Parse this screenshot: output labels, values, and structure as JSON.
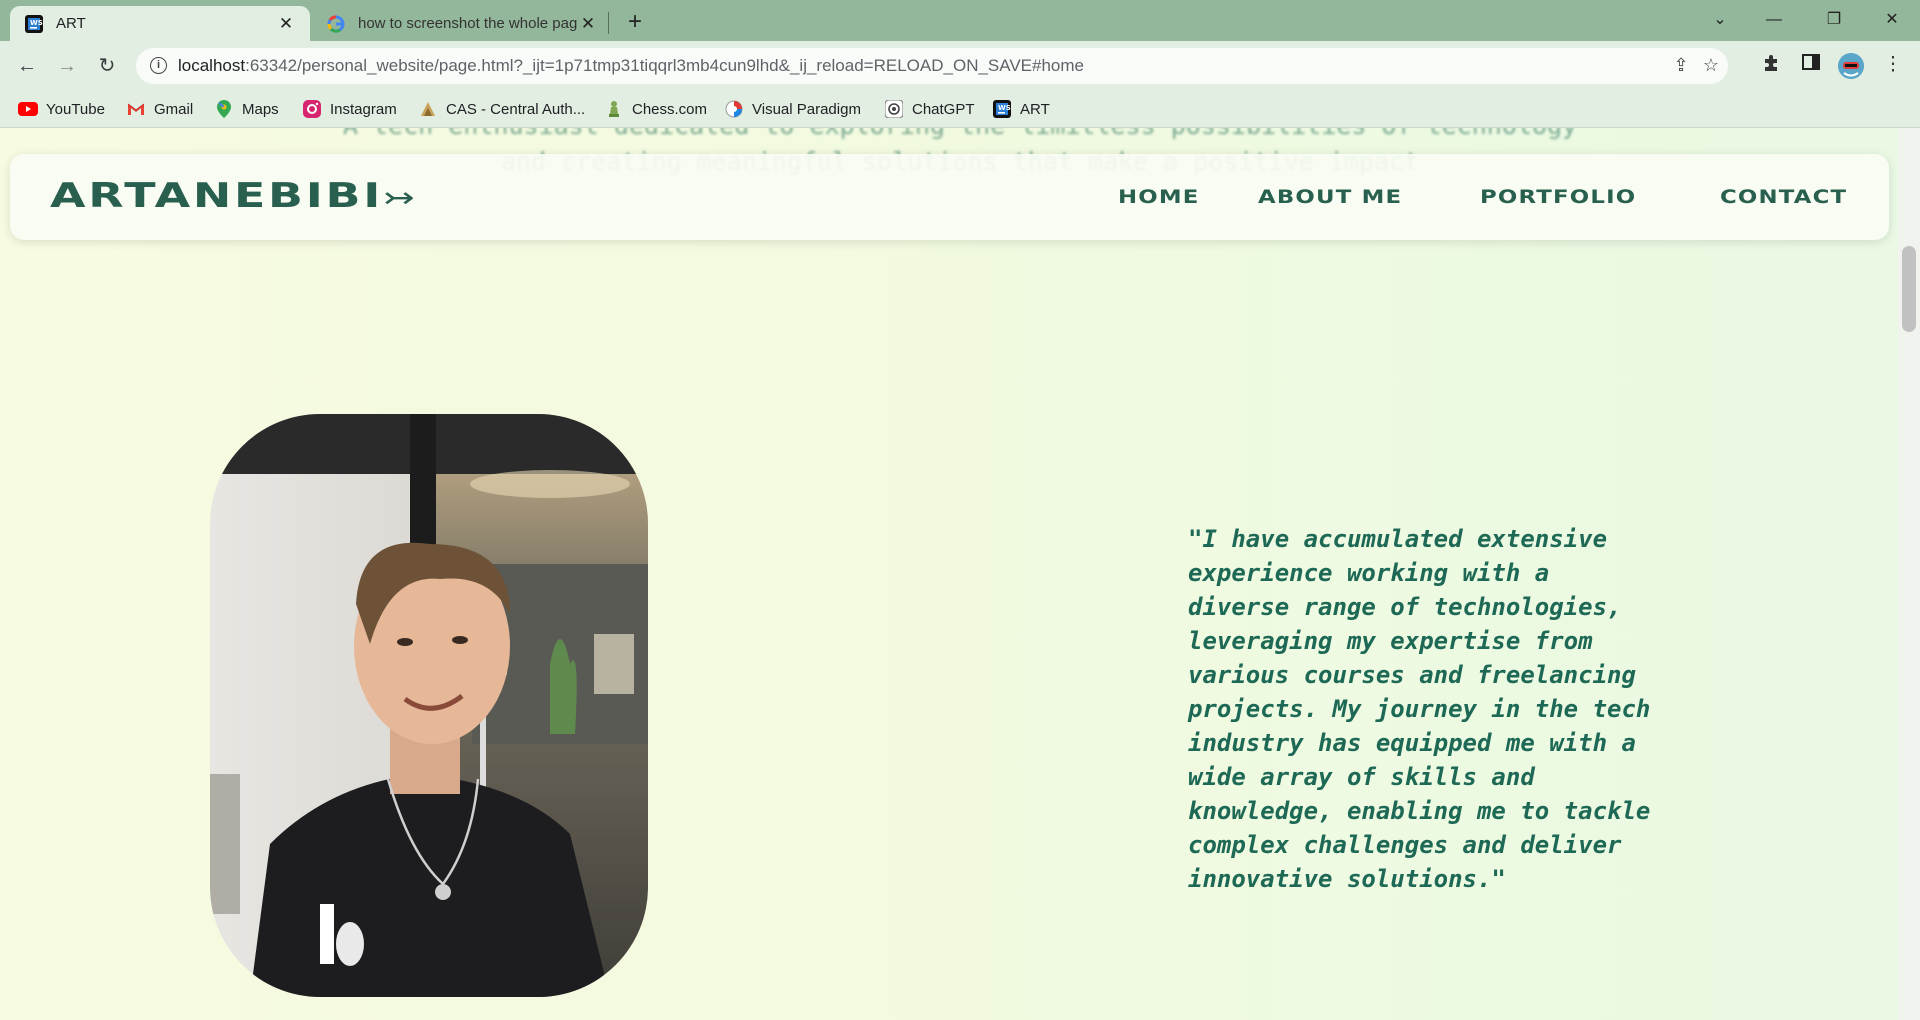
{
  "browser": {
    "tabs": [
      {
        "title": "ART",
        "favicon": "intellij-icon",
        "active": true
      },
      {
        "title": "how to screenshot the whole pag",
        "favicon": "google-icon",
        "active": false
      }
    ],
    "new_tab": "+",
    "window_controls": {
      "tab_search": "⌄",
      "minimize": "—",
      "restore": "❐",
      "close": "✕"
    },
    "url": {
      "host": "localhost",
      "rest": ":63342/personal_website/page.html?_ijt=1p71tmp31tiqqrl3mb4cun9lhd&_ij_reload=RELOAD_ON_SAVE#home"
    },
    "bookmarks": [
      {
        "label": "YouTube",
        "icon": "youtube-icon"
      },
      {
        "label": "Gmail",
        "icon": "gmail-icon"
      },
      {
        "label": "Maps",
        "icon": "maps-icon"
      },
      {
        "label": "Instagram",
        "icon": "instagram-icon"
      },
      {
        "label": "CAS - Central Auth...",
        "icon": "cas-icon"
      },
      {
        "label": "Chess.com",
        "icon": "chess-icon"
      },
      {
        "label": "Visual Paradigm",
        "icon": "visual-paradigm-icon"
      },
      {
        "label": "ChatGPT",
        "icon": "chatgpt-icon"
      },
      {
        "label": "ART",
        "icon": "intellij-icon"
      }
    ],
    "scroll_position": 0.12
  },
  "page": {
    "hero_text_line1": "A tech enthusiast dedicated to exploring the limitless possibilities of technology",
    "hero_text_line2": "and creating meaningful solutions that make a positive impact",
    "logo": "ARTANEBIBI",
    "logo_arrow": "↣",
    "nav": {
      "home": "HOME",
      "about": "ABOUT ME",
      "portfolio": "PORTFOLIO",
      "contact": "CONTACT"
    },
    "quote": "\"I have accumulated extensive\nexperience working with a\ndiverse range of technologies,\nleveraging my expertise from\nvarious courses and freelancing\nprojects. My journey in the tech\nindustry has equipped me with a\nwide array of skills and\nknowledge, enabling me to tackle\ncomplex challenges and deliver\ninnovative solutions.\""
  },
  "colors": {
    "brand": "#285f4e",
    "text": "#1e6955",
    "tabbar": "#93b79a",
    "toolbar": "#e3eee3"
  }
}
